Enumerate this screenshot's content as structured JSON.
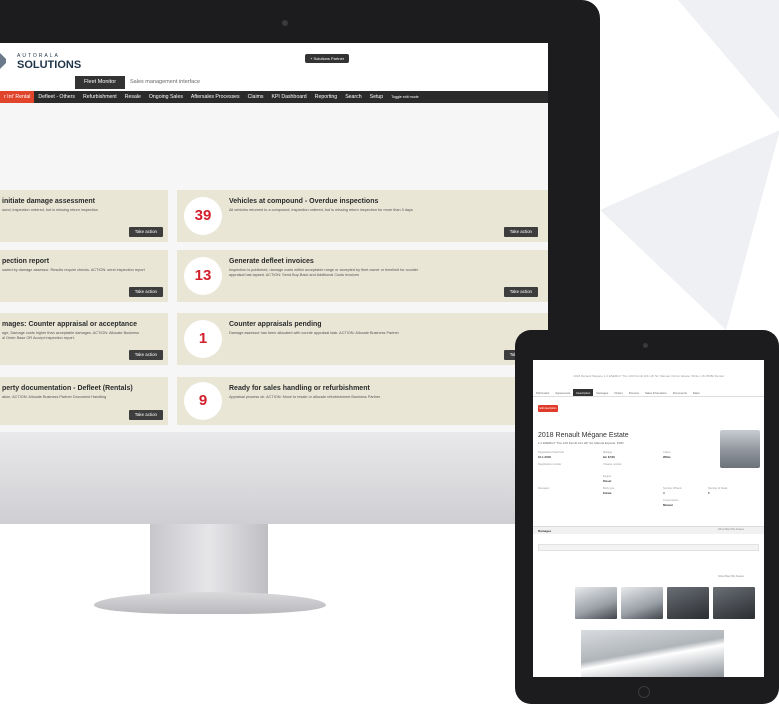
{
  "app": {
    "logo_top": "AUTORALA",
    "logo_main": "SOLUTIONS",
    "partner_button": "+ Solutions Partner",
    "module_tabs": [
      "Fleet Monitor",
      "Sales management interface"
    ],
    "nav": [
      "r Int' Rental",
      "Defleet - Others",
      "Refurbishment",
      "Resale",
      "Ongoing Sales",
      "Aftersales Processes",
      "Claims",
      "KPI Dashboard",
      "Reporting",
      "Search",
      "Setup",
      "Toggle edit mode"
    ]
  },
  "cards_left": [
    {
      "title": "initiate damage assessment",
      "desc": "ound, inspection ordered, but is missing return inspection",
      "action": "Take action"
    },
    {
      "title": "pection report",
      "desc": "oaded by damage assessor. Results require checks. ACTION: send inspection report",
      "action": "Take action"
    },
    {
      "title": "mages: Counter appraisal or acceptance",
      "desc": "age, Damage costs higher than acceptable damages. ACTION: Allocate Business\nal Order Base OR Accept inspection report.",
      "action": "Take action"
    },
    {
      "title": "perty documentation - Defleet (Rentals)",
      "desc": "ation. ACTION: Allocate Business Partner Document Handling",
      "action": "Take action"
    }
  ],
  "cards_right": [
    {
      "count": "39",
      "title": "Vehicles at compound - Overdue inspections",
      "desc": "All vehicles returned to a compound, inspection ordered, but is missing return inspection for more than 3 days",
      "action": "Take action"
    },
    {
      "count": "13",
      "title": "Generate defleet invoices",
      "desc": "Inspection is published, damage costs within acceptable range or accepted by fleet owner or timelimit for counter\nappraisal has lapsed. ACTION: Send Buy-Back and Additional Costs Invoices",
      "action": "Take action"
    },
    {
      "count": "1",
      "title": "Counter appraisals pending",
      "desc": "Damage assessor has been allocated with counte appraisal task. ACTION: Allocate Business Partner",
      "action": "Take action"
    },
    {
      "count": "9",
      "title": "Ready for sales handling or refurbishment",
      "desc": "Appraisal process ok. ACTION: Move to resale or allocate refurbishment Business Partner",
      "action": "Ta"
    }
  ],
  "tablet": {
    "header": "2018 Renault Mégane 1.2 ENERGY TCe 100 Pemlit 101 HP, 5d, Manual, Petrol, Estate, White, HN 35082 Rental",
    "tabs": [
      "Particulars",
      "Agreements",
      "Description",
      "Damages",
      "Orders",
      "Process",
      "Sales Information",
      "Documents",
      "Datar"
    ],
    "active_tab": "Description",
    "button": "Edit description",
    "title": "2018 Renault Mégane Estate",
    "subtitle": "1.2 ENERGY TCe 100 Pemlit 101 HP, 5d, Manual Expand, PWD",
    "fields": [
      {
        "label": "Registration Date/Year",
        "value": "10-1-2018"
      },
      {
        "label": "Mileage",
        "value": "km 8,540"
      },
      {
        "label": "Colour",
        "value": "White"
      },
      {
        "label": "Registration number",
        "value": ""
      },
      {
        "label": "Chassis number",
        "value": ""
      },
      {
        "label": "Engine",
        "value": "Diesel"
      },
      {
        "label": "Damages",
        "value": ""
      },
      {
        "label": "Body type",
        "value": "Estate"
      },
      {
        "label": "Number Wheels",
        "value": "4"
      },
      {
        "label": "Number of Seats",
        "value": "5"
      },
      {
        "label": "Transmission",
        "value": "Manual"
      }
    ],
    "damages_label": "Damages",
    "damages_link": "Show Bas (52) Assess",
    "photos_link": "Show Bas (52) Assess"
  }
}
